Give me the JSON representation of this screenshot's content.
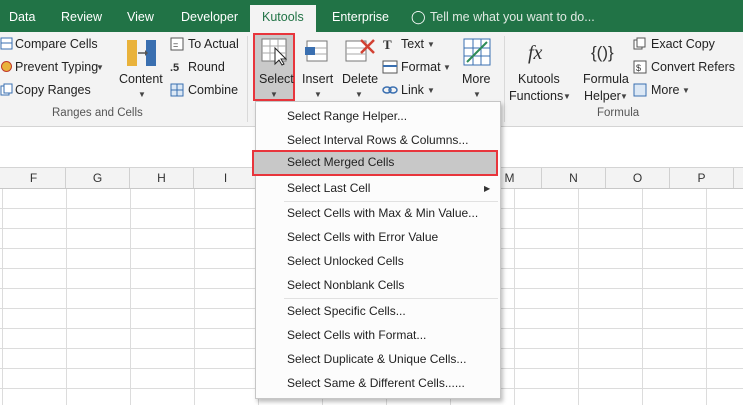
{
  "tabs": {
    "data": "Data",
    "review": "Review",
    "view": "View",
    "developer": "Developer",
    "kutools": "Kutools",
    "enterprise": "Enterprise",
    "tell_me": "Tell me what you want to do..."
  },
  "ribbon": {
    "ranges_cells": {
      "compare": "Compare Cells",
      "prevent": "Prevent Typing",
      "copy_ranges": "Copy Ranges",
      "content": "Content",
      "to_actual": "To Actual",
      "round": "Round",
      "combine": "Combine",
      "group_label": "Ranges and Cells"
    },
    "editing": {
      "select": "Select",
      "insert": "Insert",
      "delete": "Delete",
      "text": "Text",
      "format": "Format",
      "link": "Link",
      "more": "More"
    },
    "formula": {
      "kutools_functions_1": "Kutools",
      "kutools_functions_2": "Functions",
      "formula_helper_1": "Formula",
      "formula_helper_2": "Helper",
      "exact_copy": "Exact Copy",
      "convert_refers": "Convert Refers",
      "more": "More",
      "group_label": "Formula"
    }
  },
  "columns": [
    "F",
    "G",
    "H",
    "I",
    "M",
    "N",
    "O",
    "P"
  ],
  "menu": {
    "items": [
      "Select Range Helper...",
      "Select Interval Rows & Columns...",
      "Select Merged Cells",
      "Select Last Cell",
      "Select Cells with Max & Min Value...",
      "Select Cells with Error Value",
      "Select Unlocked Cells",
      "Select Nonblank Cells",
      "Select Specific Cells...",
      "Select Cells with Format...",
      "Select Duplicate & Unique Cells...",
      "Select Same & Different Cells......"
    ]
  },
  "colors": {
    "tab_bar": "#217346",
    "ribbon_bg": "#f3f3f3",
    "highlight_border": "#e8353c"
  }
}
